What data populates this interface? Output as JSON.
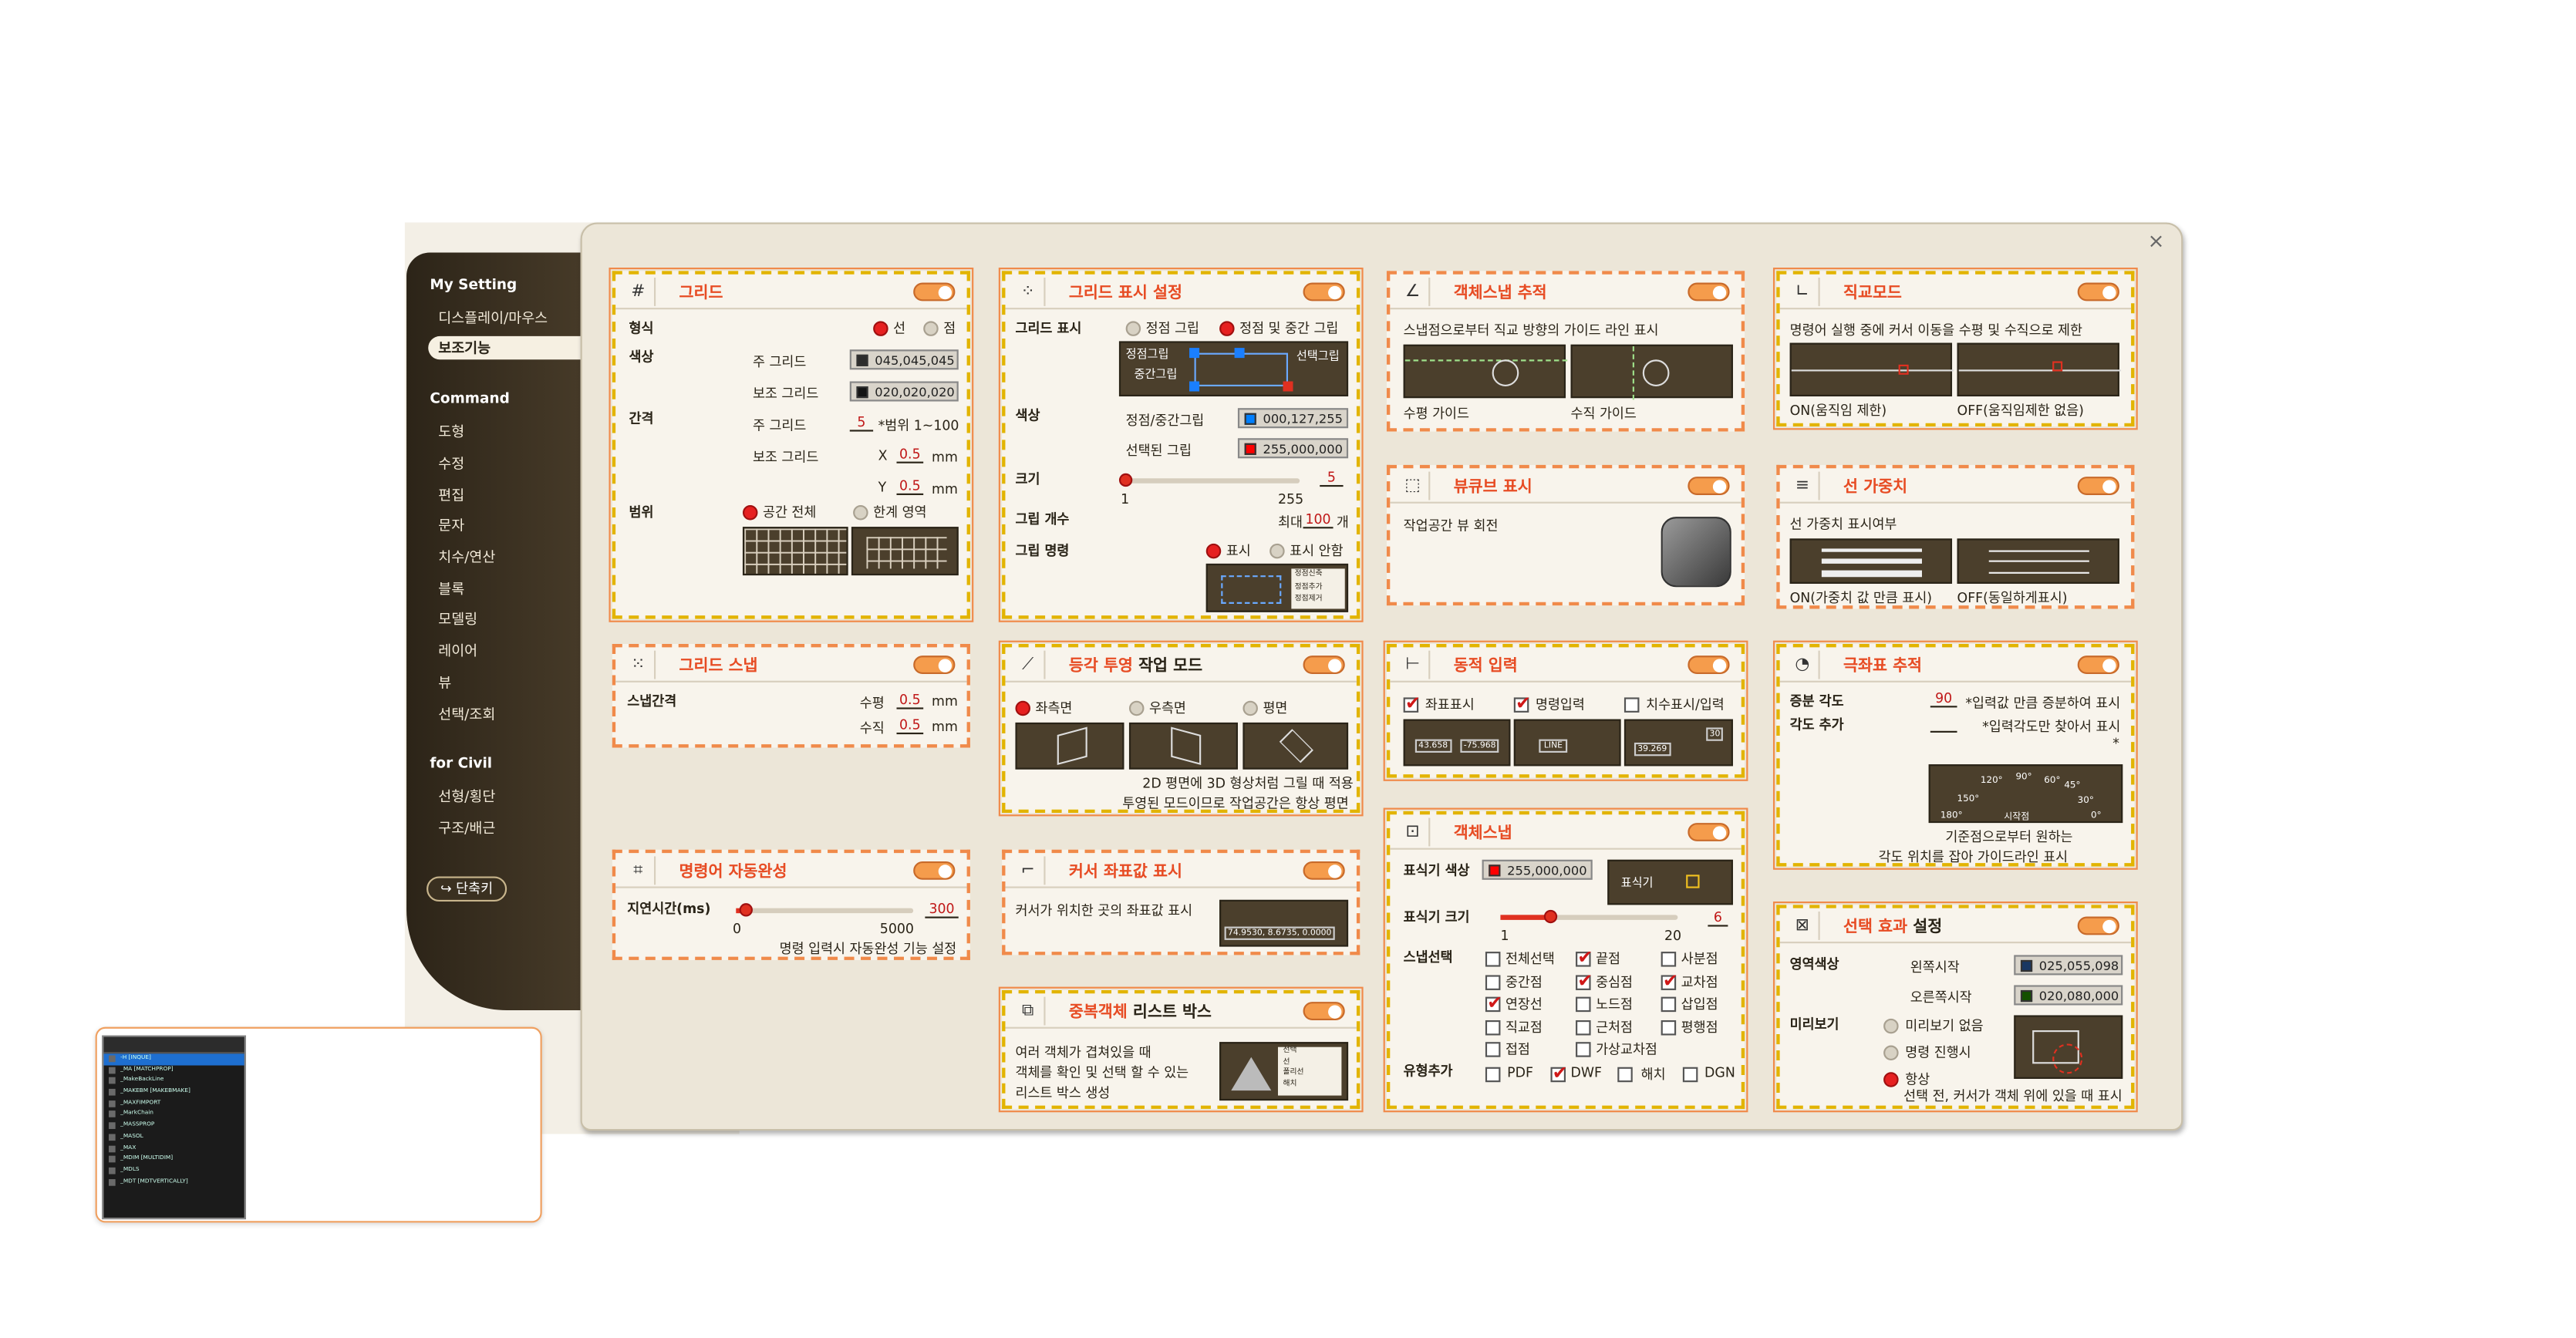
{
  "sidebar": {
    "sections": [
      {
        "title": "My Setting",
        "items": [
          "디스플레이/마우스",
          "보조기능"
        ]
      },
      {
        "title": "Command",
        "items": [
          "도형",
          "수정",
          "편집",
          "문자",
          "치수/연산",
          "블록",
          "모델링",
          "레이어",
          "뷰",
          "선택/조회"
        ]
      },
      {
        "title": "for Civil",
        "items": [
          "선형/횡단",
          "구조/배근"
        ]
      }
    ],
    "active": "보조기능",
    "shortcut_label": "단축키"
  },
  "close_label": "×",
  "grid": {
    "title": "그리드",
    "type_label": "형식",
    "type_opt1": "선",
    "type_opt2": "점",
    "color_label": "색상",
    "major_label": "주 그리드",
    "major_color": "045,045,045",
    "minor_label": "보조 그리드",
    "minor_color": "020,020,020",
    "spacing_label": "간격",
    "spacing_major": "주 그리드",
    "spacing_major_val": "5",
    "spacing_range": "*범위 1~100",
    "spacing_minor": "보조 그리드",
    "x_label": "X",
    "x_val": "0.5",
    "unit": "mm",
    "y_label": "Y",
    "y_val": "0.5",
    "range_label": "범위",
    "range_opt1": "공간 전체",
    "range_opt2": "한계 영역"
  },
  "grid_display": {
    "title": "그리드 표시 설정",
    "display_label": "그리드 표시",
    "opt1": "정점 그립",
    "opt2": "정점 및 중간 그립",
    "diag_vertex": "정점그립",
    "diag_mid": "중간그립",
    "diag_sel": "선택그립",
    "color_label": "색상",
    "vm_label": "정점/중간그립",
    "vm_color": "000,127,255",
    "sel_label": "선택된 그립",
    "sel_color": "255,000,000",
    "size_label": "크기",
    "size_min": "1",
    "size_max": "255",
    "size_val": "5",
    "count_label": "그립 개수",
    "count_max": "최대",
    "count_val": "100",
    "count_unit": "개",
    "cmd_label": "그립 명령",
    "cmd_opt1": "표시",
    "cmd_opt2": "표시 안함",
    "menu": [
      "정점신축",
      "정점추가",
      "정점제거"
    ]
  },
  "osnap_track": {
    "title": "객체스냅 추적",
    "desc": "스냅점으로부터 직교 방향의 가이드 라인 표시",
    "h_guide": "수평 가이드",
    "v_guide": "수직 가이드"
  },
  "ortho": {
    "title": "직교모드",
    "desc": "명령어 실행 중에 커서 이동을 수평 및 수직으로 제한",
    "on": "ON(움직임 제한)",
    "off": "OFF(움직임제한 없음)"
  },
  "viewcube": {
    "title": "뷰큐브 표시",
    "desc": "작업공간 뷰 회전"
  },
  "lineweight": {
    "title": "선 가중치",
    "desc": "선 가중치 표시여부",
    "on": "ON(가중치 값 만큼 표시)",
    "off": "OFF(동일하게표시)"
  },
  "grid_snap": {
    "title": "그리드 스냅",
    "spacing_label": "스냅간격",
    "h_label": "수평",
    "h_val": "0.5",
    "v_label": "수직",
    "v_val": "0.5",
    "unit": "mm"
  },
  "isometric": {
    "title_a": "등각 투영",
    "title_b": "작업 모드",
    "opt1": "좌측면",
    "opt2": "우측면",
    "opt3": "평면",
    "desc1": "2D 평면에 3D 형상처럼 그릴 때 적용",
    "desc2": "투영된 모드이므로 작업공간은 항상 평면"
  },
  "dyn_input": {
    "title": "동적 입력",
    "opt1": "좌표표시",
    "opt2": "명령입력",
    "opt3": "치수표시/입력",
    "x": "43.658",
    "y": "-75.968",
    "cmd": "LINE",
    "dim": "39.269",
    "ang": "30"
  },
  "polar": {
    "title": "극좌표 추적",
    "inc_label": "증분 각도",
    "inc_val": "90",
    "inc_desc": "*입력값 만큼 증분하여 표시",
    "add_label": "각도 추가",
    "add_desc": "*입력각도만 찾아서 표시",
    "star": "*",
    "angles": [
      "120°",
      "90°",
      "60°",
      "45°",
      "30°",
      "150°",
      "180°",
      "0°"
    ],
    "start": "시작점",
    "desc1": "기준점으로부터 원하는",
    "desc2": "각도 위치를 잡아 가이드라인 표시"
  },
  "autocomplete": {
    "title": "명령어 자동완성",
    "delay_label": "지연시간(ms)",
    "min": "0",
    "max": "5000",
    "val": "300",
    "desc": "명령 입력시 자동완성 기능 설정"
  },
  "cursor_coord": {
    "title": "커서 좌표값 표시",
    "desc": "커서가 위치한 곳의 좌표값 표시",
    "coord": "74.9530, 8.6735, 0.0000"
  },
  "osnap": {
    "title": "객체스냅",
    "color_label": "표식기 색상",
    "color": "255,000,000",
    "marker": "표식기",
    "size_label": "표식기 크기",
    "size_min": "1",
    "size_max": "20",
    "size_val": "6",
    "sel_label": "스냅선택",
    "items": [
      [
        "전체선택",
        "끝점",
        "사분점"
      ],
      [
        "중간점",
        "중심점",
        "교차점"
      ],
      [
        "연장선",
        "노드점",
        "삽입점"
      ],
      [
        "직교점",
        "근처점",
        "평행점"
      ],
      [
        "접점",
        "가상교차점",
        ""
      ]
    ],
    "type_label": "유형추가",
    "types": [
      "PDF",
      "DWF",
      "해치",
      "DGN"
    ]
  },
  "overlap": {
    "title_a": "중복객체",
    "title_b": "리스트 박스",
    "desc1": "여러 객체가 겹쳐있을 때",
    "desc2": "객체를 확인 및 선택 할 수 있는",
    "desc3": "리스트 박스 생성",
    "list": [
      "선택",
      "선",
      "폴리선",
      "해치"
    ]
  },
  "sel_effect": {
    "title_a": "선택 효과",
    "title_b": "설정",
    "area_label": "영역색상",
    "left_label": "왼쪽시작",
    "left_color": "025,055,098",
    "right_label": "오른쪽시작",
    "right_color": "020,080,000",
    "preview_label": "미리보기",
    "p1": "미리보기 없음",
    "p2": "명령 진행시",
    "p3": "항상",
    "desc": "선택 전, 커서가 객체 위에 있을 때 표시"
  },
  "mini": {
    "lines": [
      "-H [INQUE]",
      "_MA [MATCHPROP]",
      "_MakeBackLine",
      "_MAKEBM [MAKEBMAKE]",
      "_MAXFIMPORT",
      "_MarkChain",
      "_MASSPROP",
      "_MASOL",
      "_MAX",
      "_MDIM [MULTIDIM]",
      "_MDLS",
      "_MDT [MDTVERTICALLY]"
    ]
  },
  "colors": {
    "accent": "#e74c24",
    "toggle": "#f59c4c",
    "sidebar": "#3a3020",
    "panel": "#ece6d8"
  }
}
